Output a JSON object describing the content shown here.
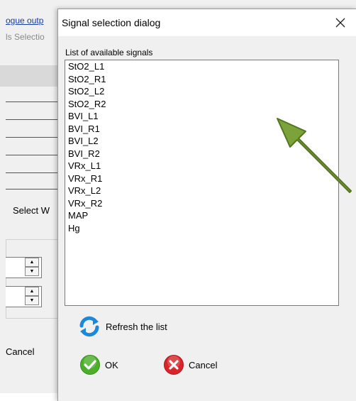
{
  "background_window": {
    "menu_link": "ogue outp",
    "subtitle": "ls Selectio",
    "select_button": "Select W",
    "cancel_button": "Cancel"
  },
  "dialog": {
    "title": "Signal selection dialog",
    "list_label": "List of available signals",
    "signals": [
      "StO2_L1",
      "StO2_R1",
      "StO2_L2",
      "StO2_R2",
      "BVI_L1",
      "BVI_R1",
      "BVI_L2",
      "BVI_R2",
      "VRx_L1",
      "VRx_R1",
      "VRx_L2",
      "VRx_R2",
      "MAP",
      "Hg"
    ],
    "refresh_label": "Refresh the list",
    "ok_label": "OK",
    "cancel_label": "Cancel"
  },
  "colors": {
    "annotation_arrow": "#7aa33a",
    "ok_icon": "#4caf2a",
    "cancel_icon": "#d9242a",
    "refresh_icon": "#1e88d8"
  }
}
